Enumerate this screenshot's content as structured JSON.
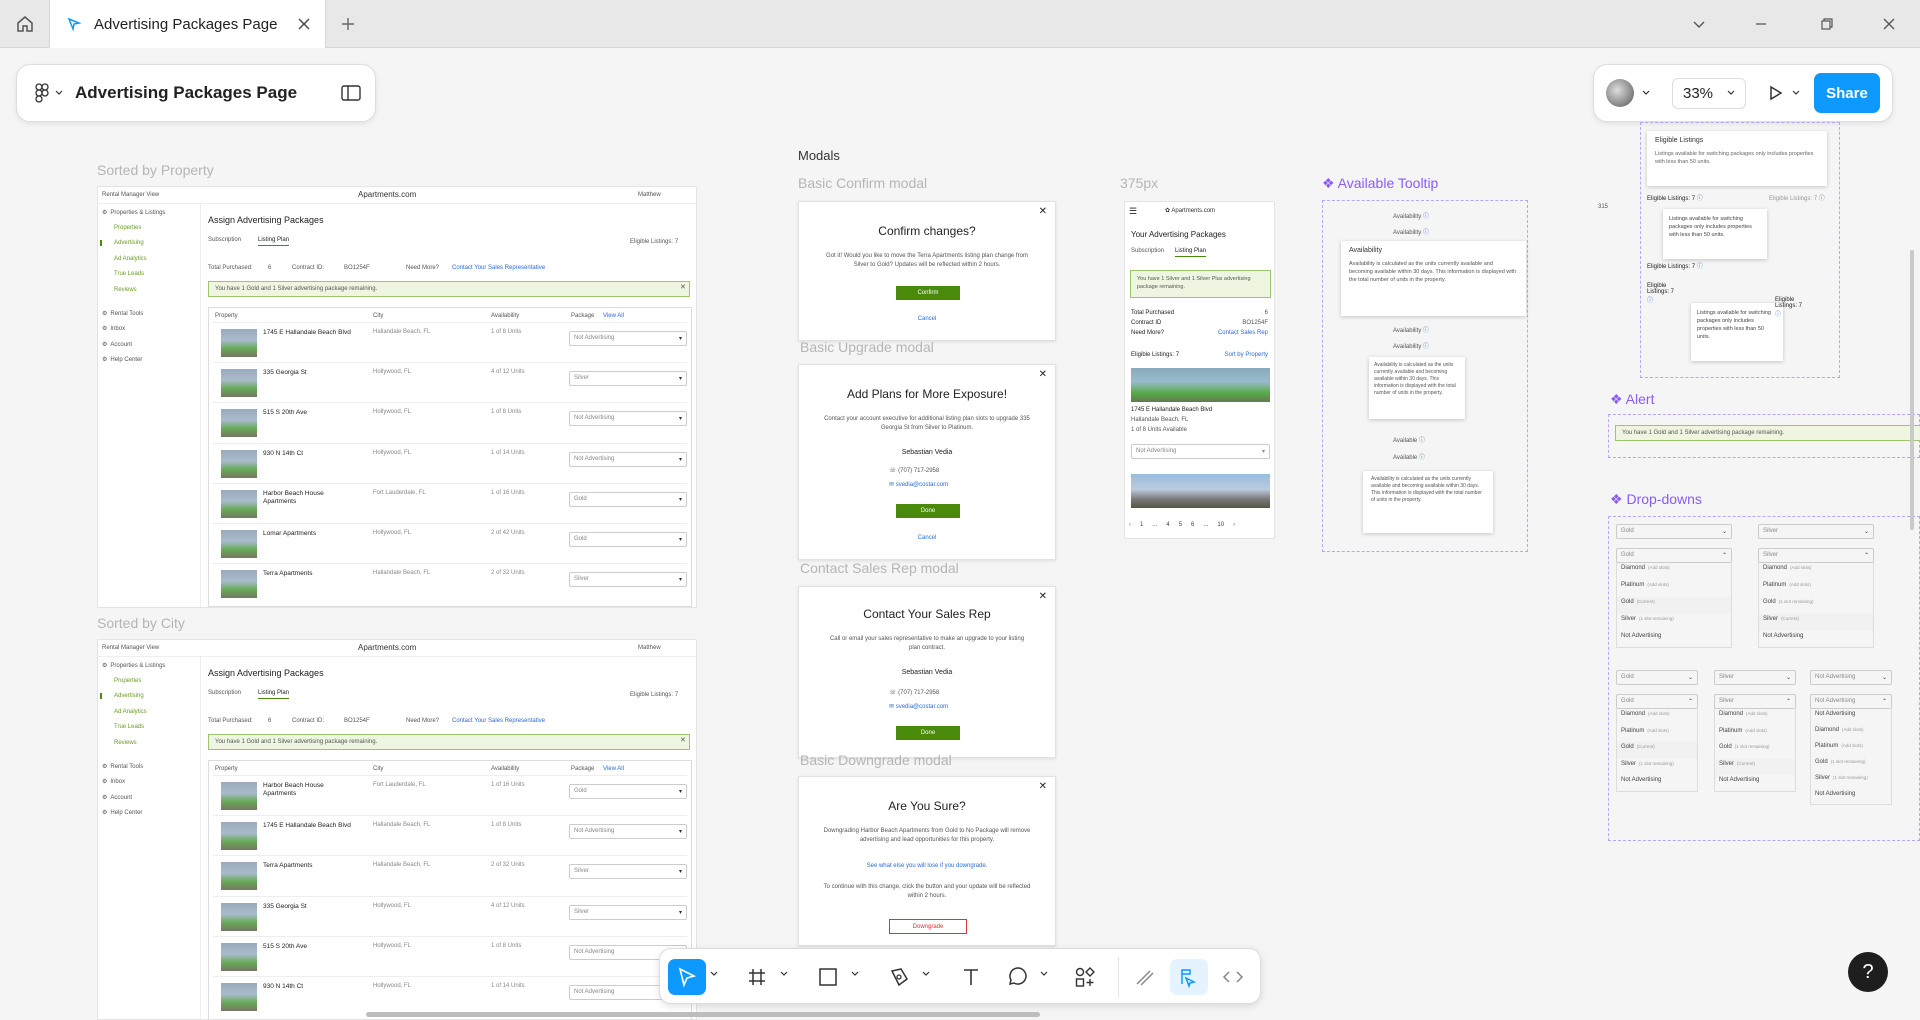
{
  "tab": {
    "title": "Advertising Packages Page"
  },
  "header": {
    "file_title": "Advertising Packages Page",
    "zoom": "33%",
    "share_label": "Share"
  },
  "canvas": {
    "sorted_property": "Sorted by Property",
    "sorted_city": "Sorted by City",
    "modals_title": "Modals",
    "basic_confirm": "Basic Confirm modal",
    "basic_upgrade": "Basic Upgrade modal",
    "contact_sales": "Contact Sales Rep modal",
    "basic_downgrade": "Basic Downgrade modal",
    "mobile_label": "375px",
    "tooltip_label": "Available Tooltip",
    "alert_label": "Alert",
    "dropdowns_label": "Drop-downs",
    "number_label": "315"
  },
  "desktop": {
    "topbar_left": "Rental Manager View",
    "logo": "Apartments.com",
    "user": "Matthew",
    "page_title": "Assign Advertising Packages",
    "tab_subscription": "Subscription",
    "tab_listing": "Listing Plan",
    "eligible": "Eligible Listings: 7",
    "total_purchased": "Total Purchased:",
    "total_val": "6",
    "contract_id": "Contract ID:",
    "contract_val": "BO1254F",
    "need_more": "Need More?",
    "contact_link": "Contact Your Sales Representative",
    "alert": "You have 1 Gold and 1 Silver advertising package remaining.",
    "col_property": "Property",
    "col_city": "City",
    "col_availability": "Availability",
    "col_package": "Package",
    "view_all": "View All",
    "nav": [
      {
        "label": "Properties & Listings",
        "active": false,
        "sub": false
      },
      {
        "label": "Properties",
        "active": false,
        "sub": true
      },
      {
        "label": "Advertising",
        "active": true,
        "sub": true
      },
      {
        "label": "Ad Analytics",
        "active": false,
        "sub": true
      },
      {
        "label": "True Leads",
        "active": false,
        "sub": true
      },
      {
        "label": "Reviews",
        "active": false,
        "sub": true
      },
      {
        "label": "Rental Tools",
        "active": false,
        "sub": false
      },
      {
        "label": "Inbox",
        "active": false,
        "sub": false
      },
      {
        "label": "Account",
        "active": false,
        "sub": false
      },
      {
        "label": "Help Center",
        "active": false,
        "sub": false
      }
    ],
    "rows_property": [
      {
        "name": "1745 E Hallandale Beach Blvd",
        "city": "Hallandale Beach, FL",
        "avail": "1 of 8 Units",
        "pkg": "Not Advertising"
      },
      {
        "name": "335 Georgia St",
        "city": "Hollywood, FL",
        "avail": "4 of 12 Units",
        "pkg": "Silver"
      },
      {
        "name": "515 S 20th Ave",
        "city": "Hollywood, FL",
        "avail": "1 of 8 Units",
        "pkg": "Not Advertising"
      },
      {
        "name": "930 N 14th Ct",
        "city": "Hollywood, FL",
        "avail": "1 of 14 Units",
        "pkg": "Not Advertising"
      },
      {
        "name": "Harbor Beach House Apartments",
        "city": "Fort Lauderdale, FL",
        "avail": "1 of 16 Units",
        "pkg": "Gold"
      },
      {
        "name": "Lomar Apartments",
        "city": "Hollywood, FL",
        "avail": "2 of 42 Units",
        "pkg": "Gold"
      },
      {
        "name": "Terra Apartments",
        "city": "Hallandale Beach, FL",
        "avail": "2 of 32 Units",
        "pkg": "Silver"
      }
    ],
    "rows_city": [
      {
        "name": "Harbor Beach House Apartments",
        "city": "Fort Lauderdale, FL",
        "avail": "1 of 16 Units",
        "pkg": "Gold"
      },
      {
        "name": "1745 E Hallandale Beach Blvd",
        "city": "Hallandale Beach, FL",
        "avail": "1 of 8 Units",
        "pkg": "Not Advertising"
      },
      {
        "name": "Terra Apartments",
        "city": "Hallandale Beach, FL",
        "avail": "2 of 32 Units",
        "pkg": "Silver"
      },
      {
        "name": "335 Georgia St",
        "city": "Hollywood, FL",
        "avail": "4 of 12 Units",
        "pkg": "Silver"
      },
      {
        "name": "515 S 20th Ave",
        "city": "Hollywood, FL",
        "avail": "1 of 8 Units",
        "pkg": "Not Advertising"
      },
      {
        "name": "930 N 14th Ct",
        "city": "Hollywood, FL",
        "avail": "1 of 14 Units",
        "pkg": "Not Advertising"
      }
    ]
  },
  "modals": {
    "confirm": {
      "title": "Confirm changes?",
      "text": "Got it! Would you like to move the Terra Apartments listing plan change from Silver to Gold? Updates will be reflected within 2 hours.",
      "primary": "Confirm",
      "cancel": "Cancel"
    },
    "upgrade": {
      "title": "Add Plans for More Exposure!",
      "text": "Contact your account executive for additional listing plan slots to upgrade 335 Georgia St from Silver to Platinum.",
      "rep": "Sebastian Vedia",
      "phone": "(707) 717-2958",
      "email": "svedia@costar.com",
      "primary": "Done",
      "cancel": "Cancel"
    },
    "contact": {
      "title": "Contact Your Sales Rep",
      "text": "Call or email your sales representative to make an upgrade to your listing plan contract.",
      "rep": "Sebastian Vedia",
      "phone": "(707) 717-2958",
      "email": "svedia@costar.com",
      "primary": "Done"
    },
    "downgrade": {
      "title": "Are You Sure?",
      "text": "Downgrading Harbor Beach Apartments from Gold to No Package will remove advertising and lead opportunities for this property.",
      "link": "See what else you will lose if you downgrade.",
      "text2": "To continue with this change, click the button and your update will be reflected within 2 hours.",
      "primary": "Downgrade"
    }
  },
  "mobile": {
    "logo": "Apartments.com",
    "title": "Your Advertising Packages",
    "tab_subscription": "Subscription",
    "tab_listing": "Listing Plan",
    "alert": "You have 1 Silver and 1 Silver Plus advertising package remaining.",
    "total": "Total Purchased",
    "total_val": "6",
    "contract": "Contract ID",
    "contract_val": "BO1254F",
    "need_more": "Need More?",
    "contact": "Contact Sales Rep",
    "eligible": "Eligible Listings: 7",
    "sort": "Sort by Property",
    "prop_name": "1745 E Hallandale Beach Blvd",
    "prop_city": "Hallandale Beach, FL",
    "prop_avail": "1 of 8 Units Available",
    "prop_pkg": "Not Advertising",
    "pages": [
      "1",
      "...",
      "4",
      "5",
      "6",
      "...",
      "10"
    ]
  },
  "tooltip": {
    "availability": "Availability",
    "available": "Available",
    "heading": "Availability",
    "body": "Availability is calculated as the units currently available and becoming available within 30 days. This information is displayed with the total number of units in the property."
  },
  "eligible_tip": {
    "heading": "Eligible Listings",
    "body": "Listings available for switching packages only includes properties with less than 50 units.",
    "label": "Eligible Listings: 7",
    "label_short": "Eligible Listings: 7"
  },
  "dropdowns": {
    "gold": "Gold",
    "silver": "Silver",
    "not_adv": "Not Advertising",
    "items": [
      {
        "label": "Diamond",
        "note": "(Add slots)"
      },
      {
        "label": "Platinum",
        "note": "(Add slots)"
      },
      {
        "label": "Gold",
        "note": "(Current)"
      },
      {
        "label": "Silver",
        "note": "(1 slot remaining)"
      },
      {
        "label": "Not Advertising",
        "note": ""
      }
    ],
    "items_silver": [
      {
        "label": "Diamond",
        "note": "(Add slots)"
      },
      {
        "label": "Platinum",
        "note": "(Add slots)"
      },
      {
        "label": "Gold",
        "note": "(1 slot remaining)"
      },
      {
        "label": "Silver",
        "note": "(Current)"
      },
      {
        "label": "Not Advertising",
        "note": ""
      }
    ],
    "items_not": [
      {
        "label": "Not Advertising",
        "note": ""
      },
      {
        "label": "Diamond",
        "note": "(Add slots)"
      },
      {
        "label": "Platinum",
        "note": "(Add slots)"
      },
      {
        "label": "Gold",
        "note": "(1 slot remaining)"
      },
      {
        "label": "Silver",
        "note": "(1 slot remaining)"
      },
      {
        "label": "Not Advertising",
        "note": ""
      }
    ]
  },
  "colors": {
    "accent": "#0d99ff",
    "green": "#4a8a0a",
    "purple": "#8a5cf6"
  }
}
